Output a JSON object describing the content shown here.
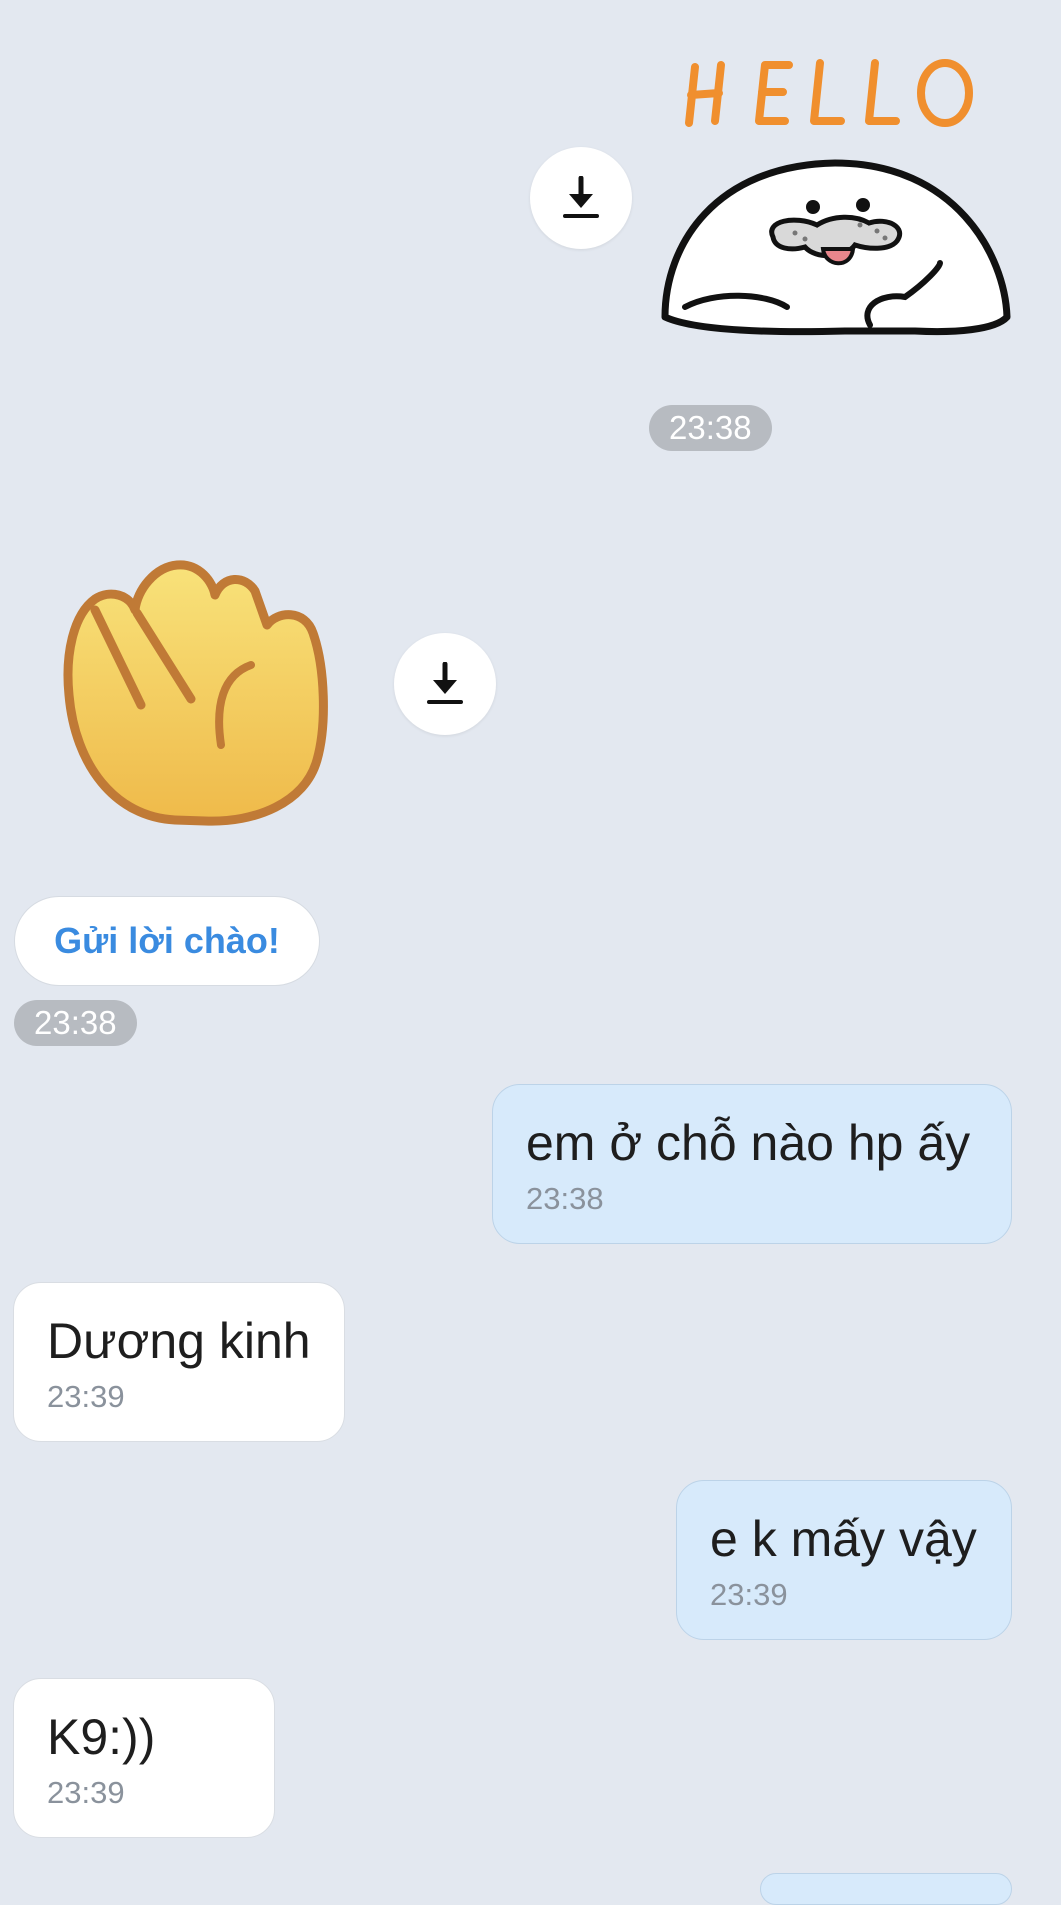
{
  "stickers": [
    {
      "name": "seal-hello-sticker",
      "text": "HELLO",
      "text_color": "#f08f2e"
    },
    {
      "name": "waving-hand-sticker",
      "icon": "waving-hand-icon"
    }
  ],
  "download_icon": "download-icon",
  "timestamps": {
    "sticker_1": "23:38",
    "sticker_2": "23:38"
  },
  "say_hello_button": "Gửi lời chào!",
  "messages": [
    {
      "side": "out",
      "text": "em ở chỗ nào hp ấy",
      "time": "23:38"
    },
    {
      "side": "in",
      "text": "Dương kinh",
      "time": "23:39"
    },
    {
      "side": "out",
      "text": "e k mấy vậy",
      "time": "23:39"
    },
    {
      "side": "in",
      "text": "K9:))",
      "time": "23:39"
    }
  ],
  "colors": {
    "background": "#e3e8f0",
    "outgoing_bubble": "#d7eafb",
    "incoming_bubble": "#ffffff",
    "accent": "#3a8be0"
  }
}
